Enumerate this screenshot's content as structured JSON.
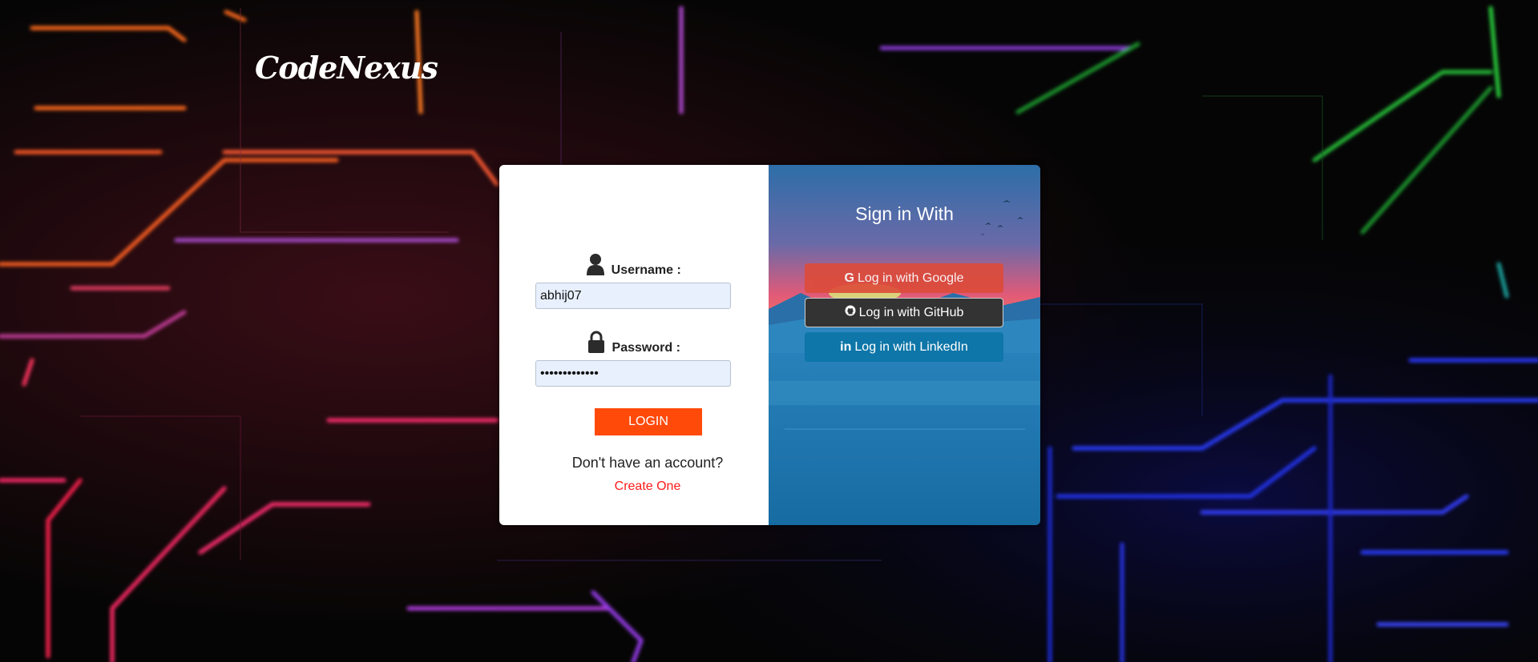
{
  "brand": {
    "name": "CodeNexus"
  },
  "login_form": {
    "username_label": "Username :",
    "username_value": "abhij07",
    "password_label": "Password :",
    "password_value": "•••••••••••••",
    "login_button": "LOGIN",
    "no_account_text": "Don't have an account?",
    "create_link": "Create One"
  },
  "social": {
    "title": "Sign in With",
    "buttons": [
      {
        "icon": "google-icon",
        "label": "Log in with Google",
        "color": "#dd4b39"
      },
      {
        "icon": "github-icon",
        "label": "Log in with GitHub",
        "color": "#333333"
      },
      {
        "icon": "linkedin-icon",
        "label": "Log in with LinkedIn",
        "color": "#0e76a8"
      }
    ]
  },
  "colors": {
    "accent": "#ff4a0a",
    "link": "#ff1a1a",
    "input_bg": "#e8f0fe"
  }
}
